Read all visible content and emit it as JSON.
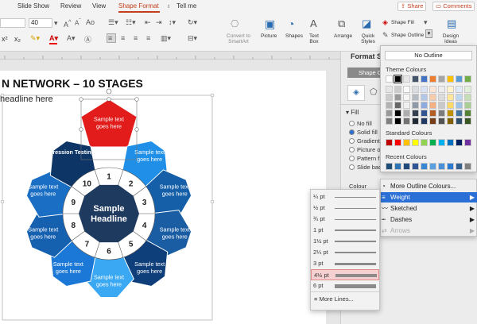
{
  "menubar": {
    "tabs": [
      "Slide Show",
      "Review",
      "View",
      "Shape Format"
    ],
    "active_tab": "Shape Format",
    "tell_me": "Tell me",
    "share": "Share",
    "comments": "Comments"
  },
  "ribbon": {
    "font_size": "40",
    "convert_label": "Convert to SmartArt",
    "picture": "Picture",
    "shapes": "Shapes",
    "text_box": "Text Box",
    "arrange": "Arrange",
    "quick_styles": "Quick Styles",
    "shape_fill": "Shape Fill",
    "shape_outline": "Shape Outline",
    "design_ideas": "Design Ideas"
  },
  "slide": {
    "title": "N NETWORK – 10 STAGES",
    "subtitle": " headline here",
    "center_text": "Sample Headline",
    "center_color": "#1f3a5f"
  },
  "segments": [
    {
      "num": "1",
      "label": "Sample text goes here",
      "color": "#e21b1b"
    },
    {
      "num": "2",
      "label": "Sample text goes here",
      "color": "#1f8fe8"
    },
    {
      "num": "3",
      "label": "Sample text goes here",
      "color": "#155fa8"
    },
    {
      "num": "4",
      "label": "Sample text goes here",
      "color": "#1a5da3"
    },
    {
      "num": "5",
      "label": "Sample text goes here",
      "color": "#0f3f7a"
    },
    {
      "num": "6",
      "label": "Sample text goes here",
      "color": "#3aa8f2"
    },
    {
      "num": "7",
      "label": "Sample text goes here",
      "color": "#1b78d6"
    },
    {
      "num": "8",
      "label": "Sample text goes here",
      "color": "#1660b0"
    },
    {
      "num": "9",
      "label": "Sample text goes here",
      "color": "#1a6fc4"
    },
    {
      "num": "10",
      "label": "Regression Testing",
      "color": "#0d3566"
    }
  ],
  "format_pane": {
    "title": "Format Sh",
    "shape_label": "Shape O",
    "section": "Fill",
    "options": [
      "No fill",
      "Solid fill",
      "Gradient",
      "Picture o",
      "Pattern f",
      "Slide bac"
    ],
    "selected_option": "Solid fill",
    "color_label": "Colour"
  },
  "color_popup": {
    "no_outline": "No Outline",
    "theme": "Theme Colours",
    "standard": "Standard Colours",
    "recent": "Recent Colours",
    "theme_top": [
      "#ffffff",
      "#000000",
      "#e7e6e6",
      "#44546a",
      "#4472c4",
      "#ed7d31",
      "#a5a5a5",
      "#ffc000",
      "#5b9bd5",
      "#70ad47"
    ],
    "standard_colors": [
      "#c00000",
      "#ff0000",
      "#ffc000",
      "#ffff00",
      "#92d050",
      "#00b050",
      "#00b0f0",
      "#0070c0",
      "#002060",
      "#7030a0"
    ],
    "recent_colors": [
      "#1f4e79",
      "#2e75b6",
      "#1f497d",
      "#2f5597",
      "#3a86d4",
      "#5aa0e0",
      "#4a90d9",
      "#2b7bd0",
      "#365f91",
      "#7f7f7f"
    ]
  },
  "outline_menu": {
    "items": [
      "More Outline Colours...",
      "Weight",
      "Sketched",
      "Dashes",
      "Arrows"
    ],
    "highlighted": "Weight"
  },
  "weight_menu": {
    "items": [
      "¼ pt",
      "½ pt",
      "¾ pt",
      "1 pt",
      "1½ pt",
      "2¼ pt",
      "3 pt",
      "4½ pt",
      "6 pt"
    ],
    "selected": "4½ pt",
    "more": "More Lines..."
  }
}
